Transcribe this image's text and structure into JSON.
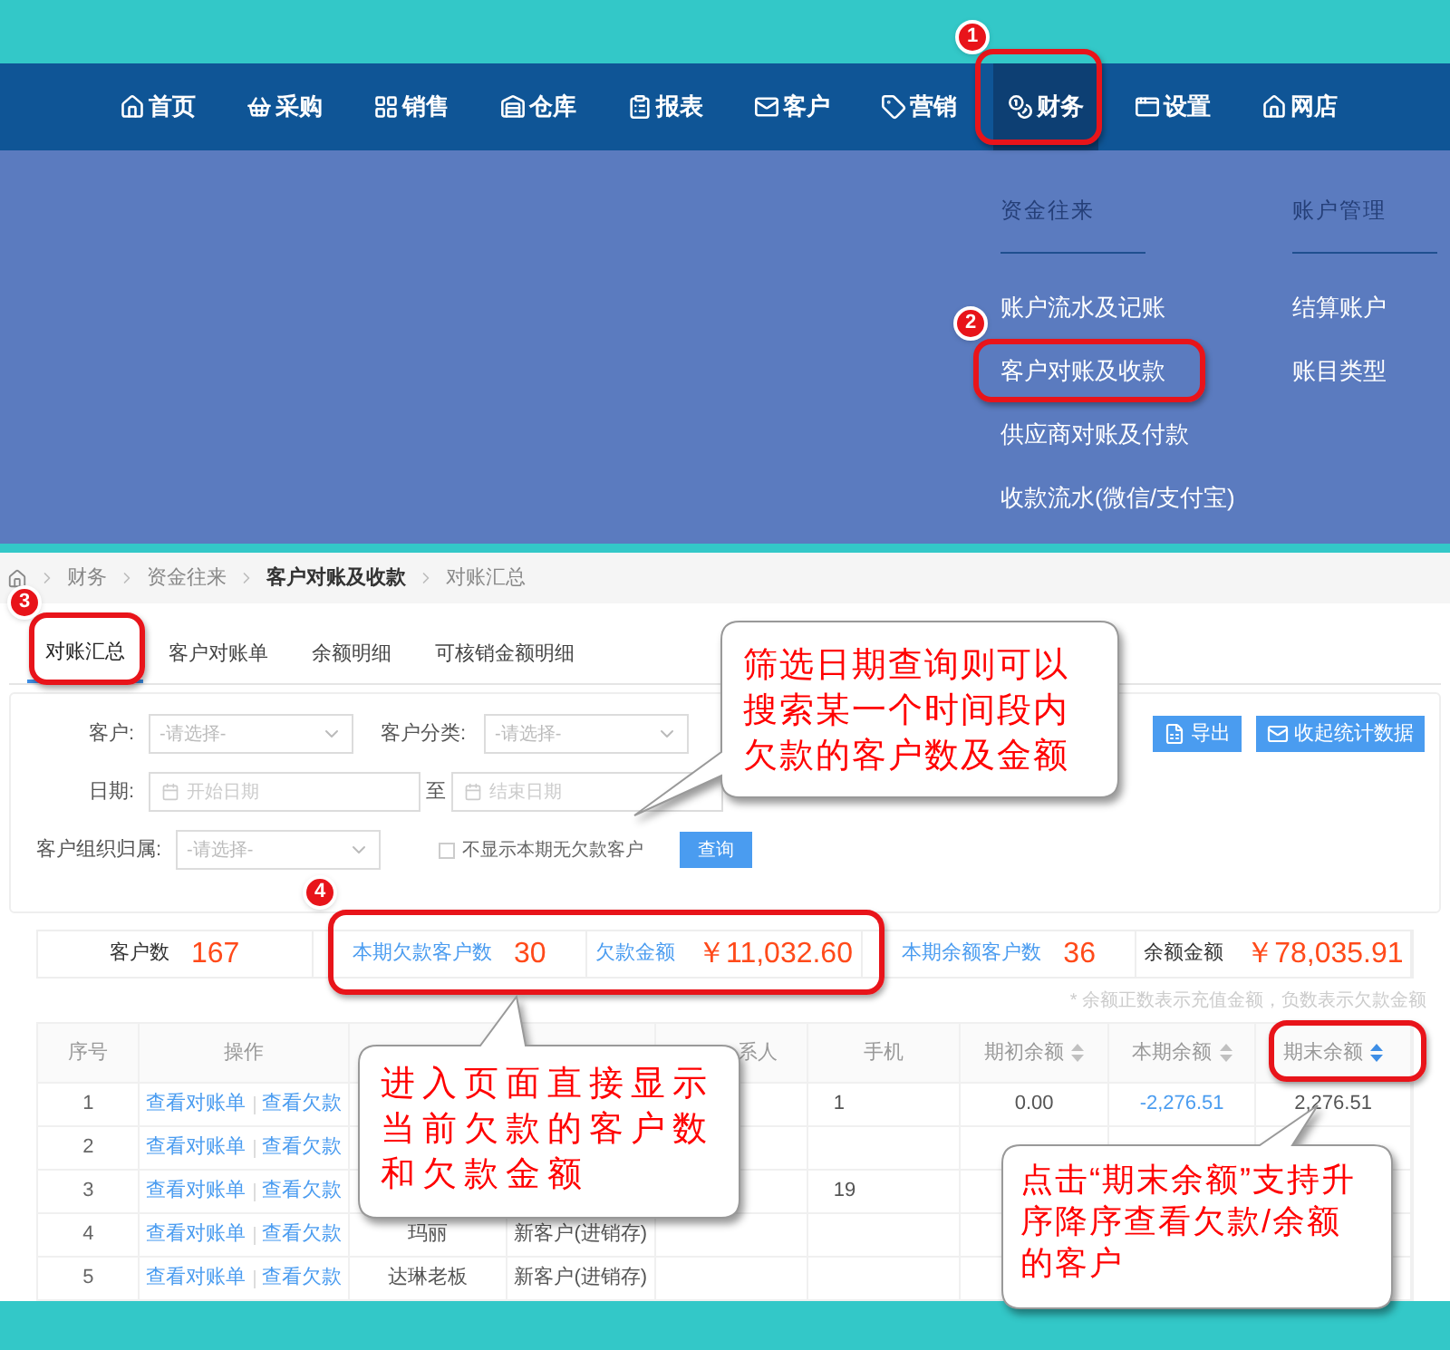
{
  "nav": {
    "items": [
      {
        "label": "首页",
        "selected": false
      },
      {
        "label": "采购",
        "selected": false
      },
      {
        "label": "销售",
        "selected": false
      },
      {
        "label": "仓库",
        "selected": false
      },
      {
        "label": "报表",
        "selected": false
      },
      {
        "label": "客户",
        "selected": false
      },
      {
        "label": "营销",
        "selected": false
      },
      {
        "label": "财务",
        "selected": true
      },
      {
        "label": "设置",
        "selected": false
      },
      {
        "label": "网店",
        "selected": false
      }
    ]
  },
  "dropdown": {
    "columns": [
      {
        "heading": "资金往来",
        "items": [
          "账户流水及记账",
          "客户对账及收款",
          "供应商对账及付款",
          "收款流水(微信/支付宝)"
        ]
      },
      {
        "heading": "账户管理",
        "items": [
          "结算账户",
          "账目类型"
        ]
      }
    ]
  },
  "breadcrumb": [
    {
      "label": "财务",
      "bold": false
    },
    {
      "label": "资金往来",
      "bold": false
    },
    {
      "label": "客户对账及收款",
      "bold": true
    },
    {
      "label": "对账汇总",
      "bold": false
    }
  ],
  "tabs": [
    {
      "label": "对账汇总",
      "selected": true
    },
    {
      "label": "客户对账单",
      "selected": false
    },
    {
      "label": "余额明细",
      "selected": false
    },
    {
      "label": "可核销金额明细",
      "selected": false
    }
  ],
  "filters": {
    "customer": {
      "label": "客户:",
      "placeholder": "-请选择-"
    },
    "category": {
      "label": "客户分类:",
      "placeholder": "-请选择-"
    },
    "date": {
      "label": "日期:",
      "start_placeholder": "开始日期",
      "separator": "至",
      "end_placeholder": "结束日期"
    },
    "org": {
      "label": "客户组织归属:",
      "placeholder": "-请选择-"
    },
    "hide_no_debt": {
      "label": "不显示本期无欠款客户",
      "checked": false
    },
    "query_button": "查询"
  },
  "actions": [
    "导出",
    "收起统计数据"
  ],
  "stats": [
    {
      "label": "客户数",
      "value": "167",
      "kind": "plain"
    },
    {
      "label": "本期欠款客户数",
      "value": "30",
      "kind": "link"
    },
    {
      "label": "欠款金额",
      "value": "￥11,032.60",
      "kind": "link"
    },
    {
      "label": "本期余额客户数",
      "value": "36",
      "kind": "link"
    },
    {
      "label": "余额金额",
      "value": "￥78,035.91",
      "kind": "plain"
    }
  ],
  "note": "* 余额正数表示充值金额，负数表示欠款金额",
  "table": {
    "columns": [
      {
        "label": "序号"
      },
      {
        "label": "操作"
      },
      {},
      {},
      {
        "label": "系人"
      },
      {
        "label": "手机"
      },
      {
        "label": "期初余额",
        "sort_active": false
      },
      {
        "label": "本期余额",
        "sort_active": false
      },
      {
        "label": "期末余额",
        "sort_active": true
      }
    ],
    "rows": [
      {
        "no": "1",
        "actions": [
          "查看对账单",
          "查看欠款"
        ],
        "values": {
          "phone": "1",
          "opening": "0.00",
          "current": "-2,276.51",
          "closing": "2,276.51"
        }
      },
      {
        "no": "2",
        "actions": [
          "查看对账单",
          "查看欠款"
        ],
        "values": {}
      },
      {
        "no": "3",
        "actions": [
          "查看对账单",
          "查看欠款"
        ],
        "values": {
          "phone": "19"
        }
      },
      {
        "no": "4",
        "actions": [
          "查看对账单",
          "查看欠款"
        ],
        "values": {
          "column_3": "玛丽",
          "column_4": "新客户(进销存)"
        }
      },
      {
        "no": "5",
        "actions": [
          "查看对账单",
          "查看欠款"
        ],
        "values": {
          "column_3": "达琳老板",
          "column_4": "新客户(进销存)"
        }
      }
    ]
  },
  "annotations": {
    "steps": [
      "1",
      "2",
      "3",
      "4"
    ],
    "callouts": [
      "筛选日期查询则可以搜索某一个时间段内欠款的客户数及金额",
      "进入页面直接显示当前欠款的客户数和欠款金额",
      "点击“期末余额”支持升序降序查看欠款/余额的客户"
    ]
  }
}
